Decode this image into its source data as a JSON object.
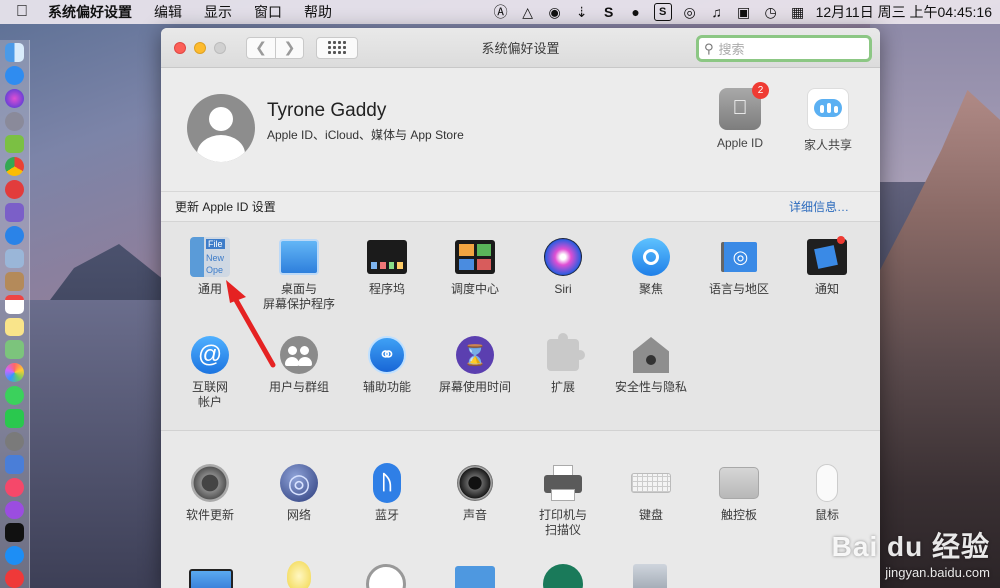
{
  "menubar": {
    "app_name": "系统偏好设置",
    "items": [
      "编辑",
      "显示",
      "窗口",
      "帮助"
    ],
    "clock": "12月11日 周三 上午04:45:16"
  },
  "window": {
    "title": "系统偏好设置",
    "search_placeholder": "搜索"
  },
  "account": {
    "name": "Tyrone Gaddy",
    "subtitle": "Apple ID、iCloud、媒体与 App Store",
    "apple_id_label": "Apple ID",
    "apple_id_badge": "2",
    "family_label": "家人共享"
  },
  "notice": {
    "text": "更新 Apple ID 设置",
    "link": "详细信息…"
  },
  "row1": [
    {
      "label": "通用"
    },
    {
      "label": "桌面与\n屏幕保护程序"
    },
    {
      "label": "程序坞"
    },
    {
      "label": "调度中心"
    },
    {
      "label": "Siri"
    },
    {
      "label": "聚焦"
    },
    {
      "label": "语言与地区"
    },
    {
      "label": "通知"
    }
  ],
  "general_icon_text": [
    "File",
    "New",
    "Ope"
  ],
  "row2": [
    {
      "label": "互联网\n帐户"
    },
    {
      "label": "用户与群组"
    },
    {
      "label": "辅助功能"
    },
    {
      "label": "屏幕使用时间"
    },
    {
      "label": "扩展"
    },
    {
      "label": "安全性与隐私"
    }
  ],
  "row3": [
    {
      "label": "软件更新"
    },
    {
      "label": "网络"
    },
    {
      "label": "蓝牙"
    },
    {
      "label": "声音"
    },
    {
      "label": "打印机与\n扫描仪"
    },
    {
      "label": "键盘"
    },
    {
      "label": "触控板"
    },
    {
      "label": "鼠标"
    }
  ],
  "watermark": {
    "logo": "Bai du 经验",
    "url": "jingyan.baidu.com"
  }
}
